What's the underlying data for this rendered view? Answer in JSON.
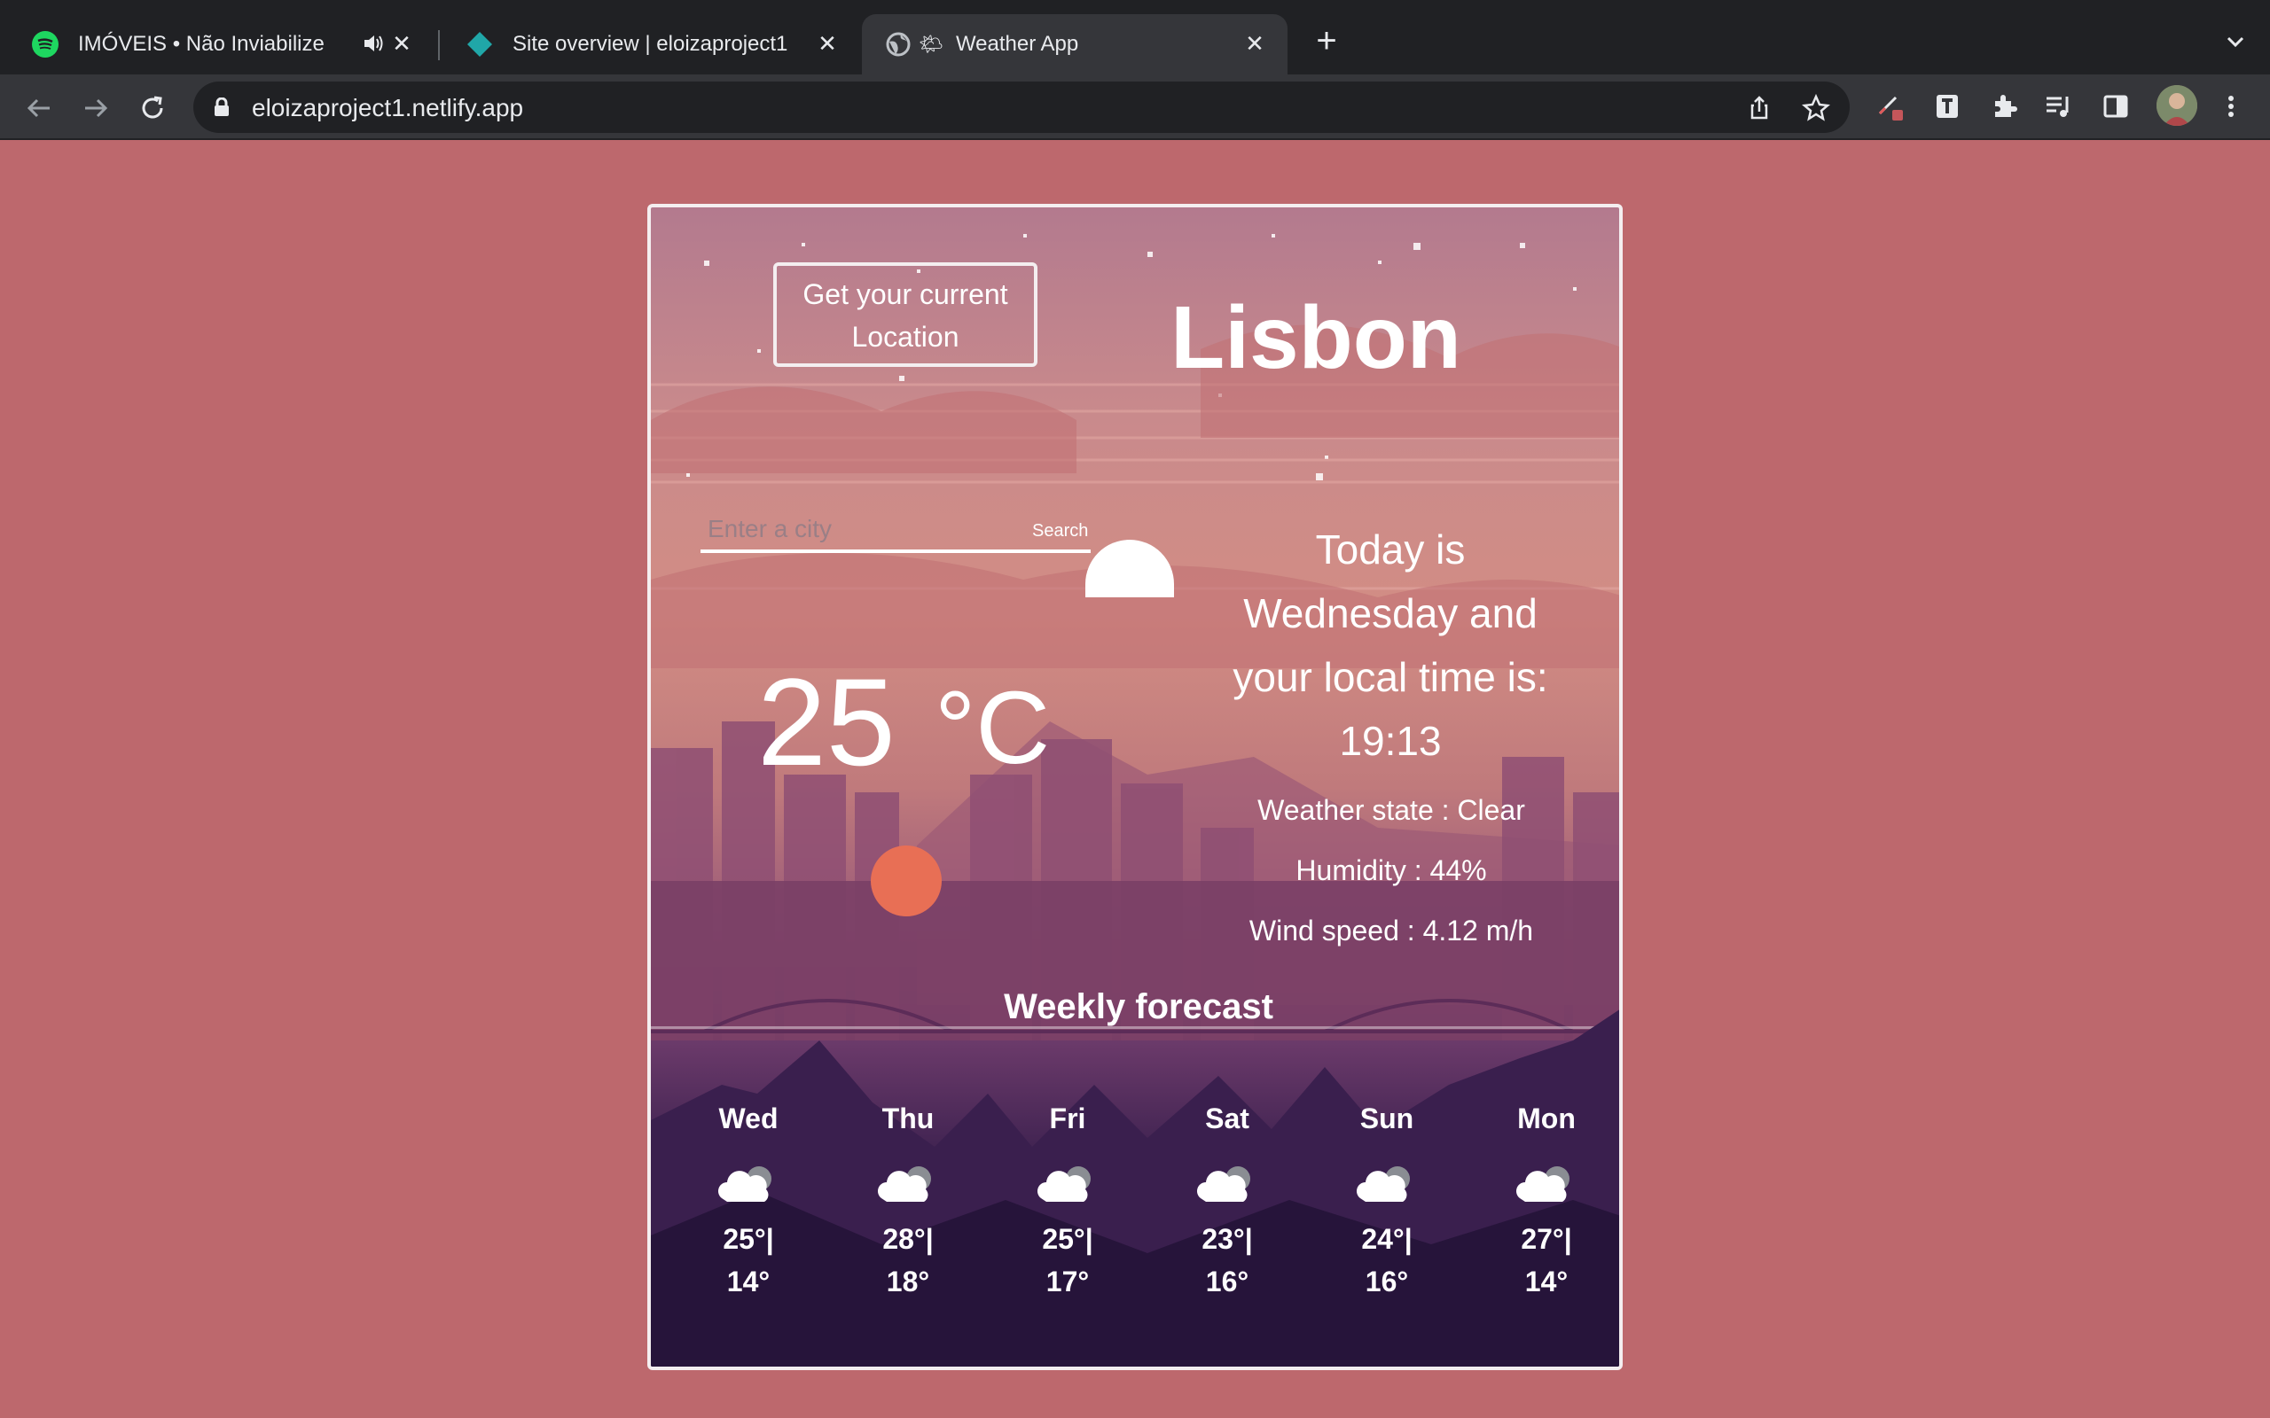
{
  "browser": {
    "tabs": [
      {
        "title": "IMÓVEIS • Não Inviabilize",
        "icon": "spotify-icon"
      },
      {
        "title": "Site overview | eloizaproject1",
        "icon": "netlify-icon"
      },
      {
        "title": "Weather App",
        "icon": "globe-icon"
      }
    ],
    "url": "eloizaproject1.netlify.app"
  },
  "app": {
    "location_button": "Get your current Location",
    "city": "Lisbon",
    "search": {
      "placeholder": "Enter a city",
      "button": "Search"
    },
    "temperature": "25",
    "unit": "°C",
    "today_line1": "Today is",
    "today_line2": "Wednesday and",
    "today_line3": "your local time is:",
    "time": "19:13",
    "weather_state": "Weather state : Clear",
    "humidity": "Humidity : 44%",
    "wind": "Wind speed : 4.12 m/h",
    "weekly_title": "Weekly forecast",
    "forecast": [
      {
        "day": "Wed",
        "max": "25°|",
        "min": "14°",
        "icon": "cloud-icon"
      },
      {
        "day": "Thu",
        "max": "28°|",
        "min": "18°",
        "icon": "cloud-icon"
      },
      {
        "day": "Fri",
        "max": "25°|",
        "min": "17°",
        "icon": "cloud-icon"
      },
      {
        "day": "Sat",
        "max": "23°|",
        "min": "16°",
        "icon": "cloud-icon"
      },
      {
        "day": "Sun",
        "max": "24°|",
        "min": "16°",
        "icon": "cloud-icon"
      },
      {
        "day": "Mon",
        "max": "27°|",
        "min": "14°",
        "icon": "cloud-icon"
      }
    ]
  },
  "colors": {
    "page_bg": "#bd686d",
    "sun": "#e86f55",
    "text": "#ffffff"
  }
}
